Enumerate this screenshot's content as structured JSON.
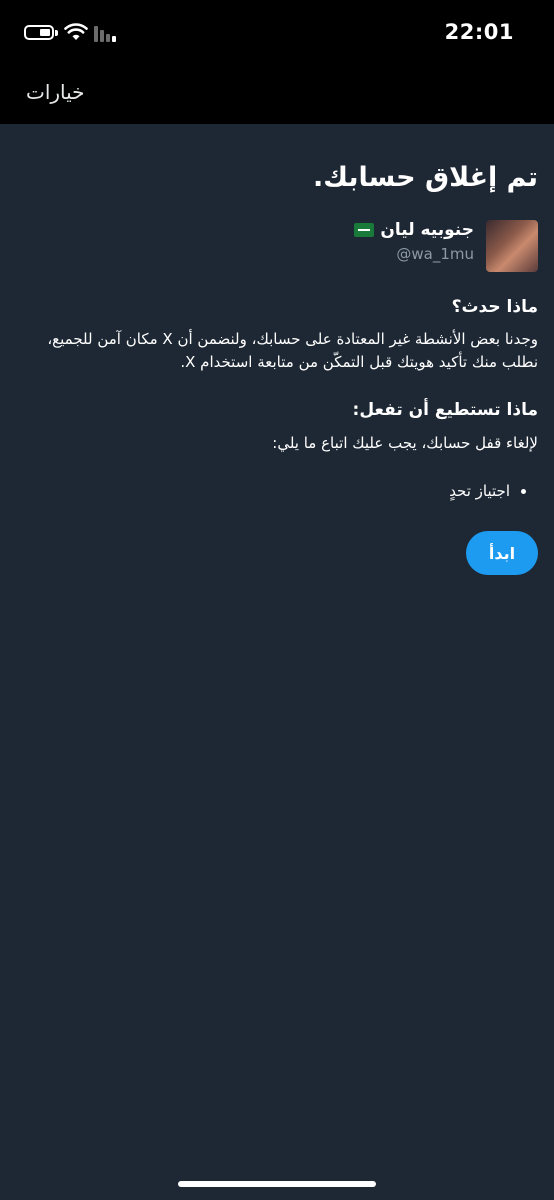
{
  "status_bar": {
    "time": "22:01"
  },
  "nav": {
    "options_label": "خيارات"
  },
  "main": {
    "title": "تم إغلاق حسابك.",
    "account": {
      "name": "جنوبيه ليان",
      "handle": "@wa_1mu",
      "flag_icon": "saudi-flag-icon"
    },
    "what_happened": {
      "heading": "ماذا حدث؟",
      "body": "وجدنا بعض الأنشطة غير المعتادة على حسابك، ولنضمن أن X مكان آمن للجميع، نطلب منك تأكيد هويتك قبل التمكّن من متابعة استخدام X."
    },
    "what_to_do": {
      "heading": "ماذا تستطيع أن تفعل:",
      "body": "لإلغاء قفل حسابك، يجب عليك اتباع ما يلي:",
      "steps": [
        "اجتياز تحدٍ"
      ]
    },
    "start_button_label": "ابدأ"
  },
  "colors": {
    "background": "#1e2834",
    "accent": "#1d9bf0",
    "secondary_text": "#8b98a5"
  }
}
